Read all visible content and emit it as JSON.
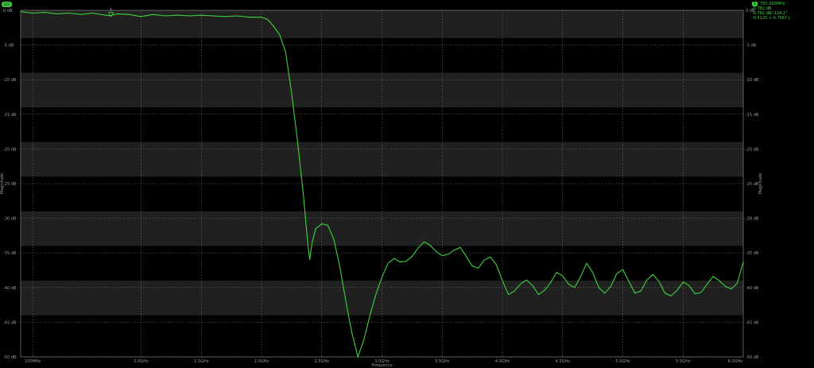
{
  "trace_badge": "S21",
  "marker_readout": {
    "marker_id": "1",
    "lines": [
      "750.000MHz",
      "-0.782 dB",
      "-0.782 dB/-124.1°",
      "-0.5125 + 0.7567 j"
    ]
  },
  "colors": {
    "trace": "#3fd23f",
    "background": "#000000",
    "band": "#202020",
    "grid": "#7a7a7a",
    "text": "#9a9a9a"
  },
  "chart_data": {
    "type": "line",
    "title": "",
    "xlabel": "Frequency",
    "ylabel": "Magnitude",
    "ylabel_right": "Magnitude",
    "xlim": [
      0.0,
      6.0
    ],
    "ylim": [
      -50,
      0
    ],
    "grid": true,
    "x_ticks": [
      {
        "value": 0.1,
        "label": "100MHz"
      },
      {
        "value": 1.0,
        "label": "1.0GHz"
      },
      {
        "value": 1.5,
        "label": "1.5GHz"
      },
      {
        "value": 2.0,
        "label": "2.0GHz"
      },
      {
        "value": 2.5,
        "label": "2.5GHz"
      },
      {
        "value": 3.0,
        "label": "3.0GHz"
      },
      {
        "value": 3.5,
        "label": "3.5GHz"
      },
      {
        "value": 4.0,
        "label": "4.0GHz"
      },
      {
        "value": 4.5,
        "label": "4.5GHz"
      },
      {
        "value": 5.0,
        "label": "5.0GHz"
      },
      {
        "value": 5.5,
        "label": "5.5GHz"
      },
      {
        "value": 6.0,
        "label": "6.0GHz"
      }
    ],
    "y_ticks": [
      {
        "value": 0,
        "label": "0 dB"
      },
      {
        "value": -5,
        "label": "-5 dB"
      },
      {
        "value": -10,
        "label": "-10 dB"
      },
      {
        "value": -15,
        "label": "-15 dB"
      },
      {
        "value": -20,
        "label": "-20 dB"
      },
      {
        "value": -25,
        "label": "-25 dB"
      },
      {
        "value": -30,
        "label": "-30 dB"
      },
      {
        "value": -35,
        "label": "-35 dB"
      },
      {
        "value": -40,
        "label": "-40 dB"
      },
      {
        "value": -45,
        "label": "-45 dB"
      },
      {
        "value": -50,
        "label": "-50 dB"
      }
    ],
    "bands": [
      [
        -4,
        0
      ],
      [
        -14,
        -9
      ],
      [
        -24,
        -19
      ],
      [
        -34,
        -29
      ],
      [
        -44,
        -39
      ]
    ],
    "marker": {
      "label": "1",
      "x": 0.75,
      "y": -0.782
    },
    "series": [
      {
        "x": [
          0,
          0.1,
          0.2,
          0.3,
          0.4,
          0.5,
          0.6,
          0.7,
          0.75,
          0.8,
          0.9,
          1.0,
          1.1,
          1.2,
          1.3,
          1.4,
          1.5,
          1.6,
          1.7,
          1.8,
          1.9,
          1.95,
          2.0,
          2.05,
          2.1,
          2.15,
          2.2,
          2.25,
          2.3,
          2.35,
          2.38,
          2.4,
          2.42,
          2.45,
          2.5,
          2.55,
          2.6,
          2.65,
          2.7,
          2.75,
          2.8,
          2.85,
          2.9,
          2.95,
          3.0,
          3.05,
          3.1,
          3.15,
          3.2,
          3.25,
          3.3,
          3.35,
          3.4,
          3.45,
          3.5,
          3.55,
          3.6,
          3.65,
          3.7,
          3.75,
          3.8,
          3.85,
          3.9,
          3.95,
          4.0,
          4.05,
          4.1,
          4.15,
          4.2,
          4.25,
          4.3,
          4.35,
          4.4,
          4.45,
          4.5,
          4.55,
          4.6,
          4.65,
          4.7,
          4.75,
          4.8,
          4.85,
          4.9,
          4.95,
          5.0,
          5.05,
          5.1,
          5.15,
          5.2,
          5.25,
          5.3,
          5.35,
          5.4,
          5.45,
          5.5,
          5.55,
          5.6,
          5.65,
          5.7,
          5.75,
          5.8,
          5.85,
          5.9,
          5.95,
          6.0
        ],
        "y": [
          -0.2,
          -0.4,
          -0.3,
          -0.5,
          -0.4,
          -0.6,
          -0.4,
          -0.7,
          -0.78,
          -0.5,
          -0.6,
          -0.9,
          -0.6,
          -0.8,
          -0.7,
          -0.8,
          -0.7,
          -0.8,
          -0.9,
          -0.8,
          -1.0,
          -1.0,
          -1.0,
          -1.3,
          -2.3,
          -3.5,
          -6.0,
          -12.0,
          -19.0,
          -27.0,
          -33.0,
          -36.0,
          -33.5,
          -31.5,
          -30.8,
          -31.0,
          -33.0,
          -37.0,
          -42.0,
          -46.5,
          -50.0,
          -47.5,
          -44.0,
          -41.0,
          -38.5,
          -36.5,
          -35.8,
          -36.3,
          -36.2,
          -35.5,
          -34.3,
          -33.4,
          -33.9,
          -34.8,
          -35.4,
          -35.2,
          -34.6,
          -34.2,
          -35.5,
          -36.9,
          -37.2,
          -36.0,
          -35.6,
          -36.7,
          -39.0,
          -41.0,
          -40.5,
          -39.5,
          -38.9,
          -39.7,
          -41.0,
          -40.4,
          -39.3,
          -37.8,
          -38.3,
          -39.5,
          -40.0,
          -38.4,
          -36.5,
          -37.8,
          -40.0,
          -40.8,
          -39.8,
          -38.0,
          -37.4,
          -39.1,
          -40.8,
          -40.5,
          -38.9,
          -38.1,
          -39.1,
          -40.8,
          -41.2,
          -40.4,
          -39.2,
          -39.7,
          -40.9,
          -40.7,
          -39.5,
          -38.4,
          -39.0,
          -39.8,
          -40.2,
          -39.4,
          -36.3
        ]
      }
    ]
  }
}
